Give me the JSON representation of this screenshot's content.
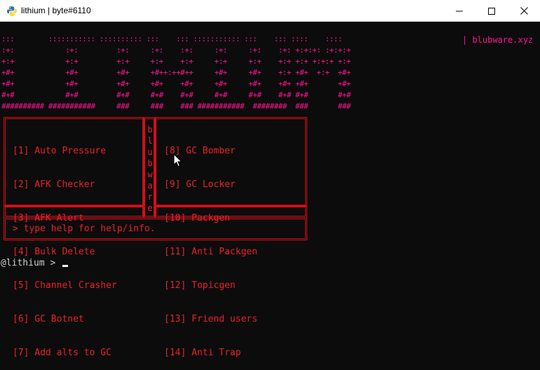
{
  "window": {
    "title": "lithium | byte#6110",
    "controls": [
      "minimize-icon",
      "maximize-icon",
      "close-icon"
    ]
  },
  "banner": {
    "ascii_lines": [
      ":::        ::::::::::: :::::::::: :::    ::: ::::::::::: :::    ::: ::::    :::: ",
      ":+:            :+:         :+:     :+:    :+:     :+:     :+:    :+: +:+:+: :+:+:+ ",
      "+:+            +:+         +:+     +:+    +:+     +:+     +:+    +:+ +:+ +:+:+ +:+ ",
      "+#+            +#+         +#+     +#++:++#++     +#+     +#+    +:+ +#+  +:+  +#+ ",
      "+#+            +#+         +#+     +#+    +#+     +#+     +#+    +#+ +#+       +#+ ",
      "#+#            #+#         #+#     #+#    #+#     #+#     #+#    #+# #+#       #+# ",
      "########## ###########     ###     ###    ### ###########  ########  ###       ### "
    ],
    "site": "| blubware.xyz"
  },
  "menu": {
    "left": [
      "[1] Auto Pressure",
      "[2] AFK Checker",
      "[3] AFK Alert",
      "[4] Bulk Delete",
      "[5] Channel Crasher",
      "[6] GC Botnet",
      "[7] Add alts to GC"
    ],
    "vertical_letters": [
      "b",
      "l",
      "u",
      "b",
      "w",
      "a",
      "r",
      "e"
    ],
    "right": [
      "[8] GC Bomber",
      "[9] GC Locker",
      "[10] Packgen",
      "[11] Anti Packgen",
      "[12] Topicgen",
      "[13] Friend users",
      "[14] Anti Trap"
    ],
    "hint": "> type help for help/info."
  },
  "prompt": {
    "text": "@lithium > "
  },
  "colors": {
    "background": "#0c0c0c",
    "banner": "#ff1493",
    "menu_text": "#e8202a",
    "box_border": "#d01018",
    "prompt": "#cccccc"
  }
}
